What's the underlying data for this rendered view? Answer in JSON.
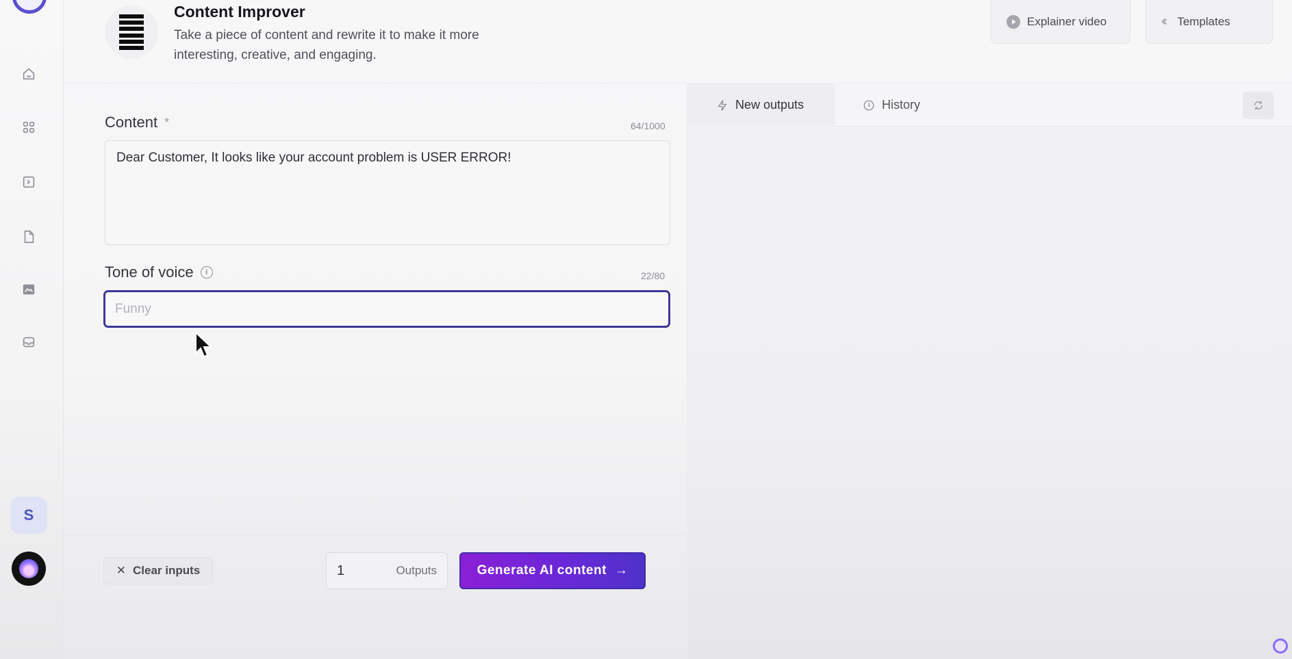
{
  "header": {
    "title": "Content Improver",
    "description": "Take a piece of content and rewrite it to make it more interesting, creative, and engaging.",
    "explainer_label": "Explainer video",
    "templates_label": "Templates"
  },
  "sidebar": {
    "items": [
      {
        "icon": "home-icon"
      },
      {
        "icon": "grid-icon"
      },
      {
        "icon": "terminal-icon"
      },
      {
        "icon": "document-icon"
      },
      {
        "icon": "image-icon"
      },
      {
        "icon": "inbox-icon"
      }
    ],
    "user_initial": "S"
  },
  "form": {
    "content": {
      "label": "Content",
      "required_mark": "*",
      "counter": "64/1000",
      "value": "Dear Customer, It looks like your account problem is USER ERROR!"
    },
    "tone": {
      "label": "Tone of voice",
      "counter": "22/80",
      "placeholder": "Funny"
    },
    "clear_label": "Clear inputs",
    "outputs_count": "1",
    "outputs_label": "Outputs",
    "generate_label": "Generate AI content"
  },
  "outputs_panel": {
    "tab_new": "New outputs",
    "tab_history": "History"
  },
  "colors": {
    "accent": "#3e3796",
    "generate_start": "#8b1fd6",
    "generate_end": "#4e32c9"
  }
}
